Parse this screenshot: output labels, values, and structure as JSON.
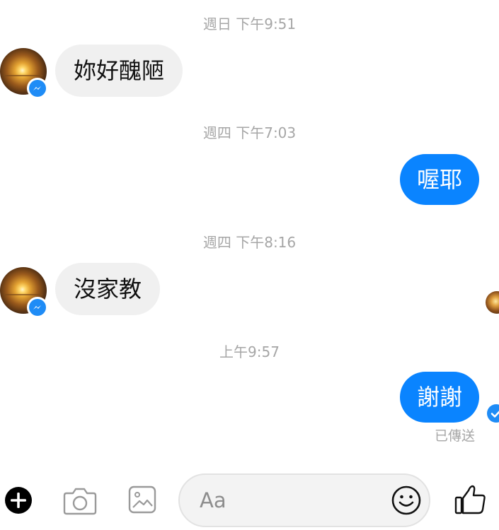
{
  "conversation": {
    "timestamps": [
      "週日 下午9:51",
      "週四 下午7:03",
      "週四 下午8:16",
      "上午9:57"
    ],
    "messages": [
      {
        "direction": "incoming",
        "text": "妳好醜陋"
      },
      {
        "direction": "outgoing",
        "text": "喔耶"
      },
      {
        "direction": "incoming",
        "text": "沒家教"
      },
      {
        "direction": "outgoing",
        "text": "謝謝"
      }
    ],
    "sent_status": "已傳送"
  },
  "composer": {
    "placeholder": "Aa"
  },
  "icons": {
    "add": "plus-circle-icon",
    "camera": "camera-icon",
    "gallery": "image-icon",
    "emoji": "smiley-icon",
    "like": "thumbs-up-icon",
    "messenger_badge": "messenger-icon",
    "sent": "check-icon"
  },
  "colors": {
    "outgoing_bubble": "#0a84ff",
    "incoming_bubble": "#f0f0f0",
    "timestamp_text": "#a6a6a6",
    "accent": "#1f8cf6"
  }
}
